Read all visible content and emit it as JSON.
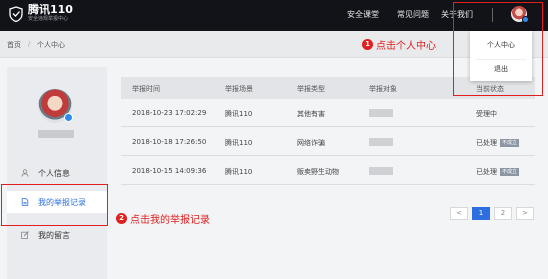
{
  "header": {
    "brand": "腾讯110",
    "brand_sub": "安全违规举报中心",
    "nav": [
      "安全课堂",
      "常见问题",
      "关于我们"
    ]
  },
  "breadcrumb": {
    "home": "首页",
    "sep": "/",
    "current": "个人中心"
  },
  "dropdown": {
    "items": [
      "个人中心",
      "退出"
    ]
  },
  "annotations": [
    {
      "num": "1",
      "text": "点击个人中心"
    },
    {
      "num": "2",
      "text": "点击我的举报记录"
    }
  ],
  "sidebar": {
    "items": [
      {
        "label": "个人信息",
        "icon": "user-icon"
      },
      {
        "label": "我的举报记录",
        "icon": "document-icon"
      },
      {
        "label": "我的留言",
        "icon": "edit-icon"
      }
    ]
  },
  "table": {
    "columns": [
      "举报时间",
      "举报场景",
      "举报类型",
      "举报对象",
      "当前状态"
    ],
    "rows": [
      {
        "time": "2018-10-23 17:02:29",
        "scene": "腾讯110",
        "type": "其他有害",
        "status": "受理中",
        "badge": ""
      },
      {
        "time": "2018-10-18 17:26:50",
        "scene": "腾讯110",
        "type": "网络诈骗",
        "status": "已处理",
        "badge": "不成立"
      },
      {
        "time": "2018-10-15 14:09:36",
        "scene": "腾讯110",
        "type": "贩卖野生动物",
        "status": "已处理",
        "badge": "不成立"
      }
    ]
  },
  "pagination": {
    "prev": "<",
    "pages": [
      "1",
      "2"
    ],
    "current": "1",
    "next": ">"
  },
  "colors": {
    "accent": "#2d6fe0",
    "annotation": "#e02020",
    "topbar": "#111318"
  }
}
